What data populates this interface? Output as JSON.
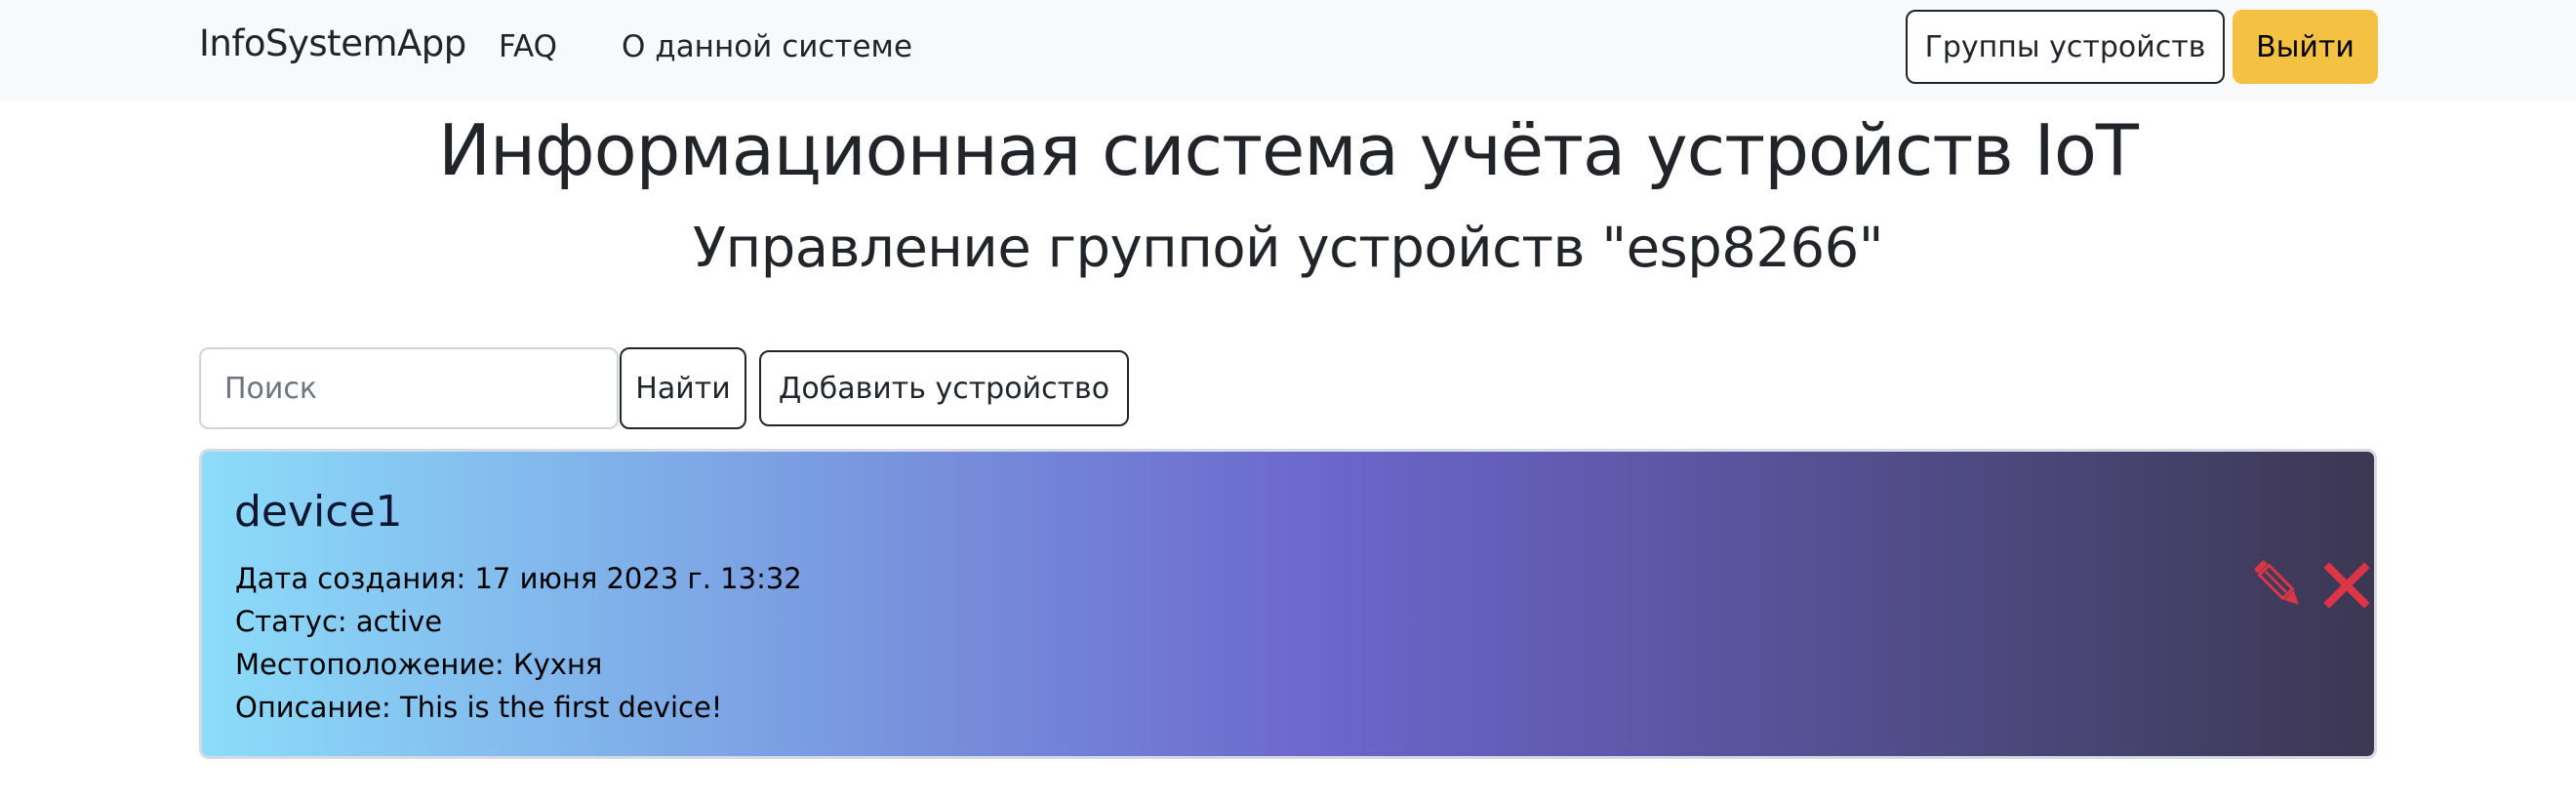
{
  "navbar": {
    "brand": "InfoSystemApp",
    "links": [
      {
        "label": "FAQ"
      },
      {
        "label": "О данной системе"
      }
    ],
    "groups_button": "Группы устройств",
    "logout_button": "Выйти"
  },
  "header": {
    "title": "Информационная система учёта устройств IoT",
    "subtitle": "Управление группой устройств \"esp8266\""
  },
  "toolbar": {
    "search_placeholder": "Поиск",
    "search_value": "",
    "find_button": "Найти",
    "add_button": "Добавить устройство"
  },
  "devices": [
    {
      "name": "device1",
      "created": "Дата создания: 17 июня 2023 г. 13:32",
      "status": "Статус: active",
      "location": "Местоположение: Кухня",
      "description": "Описание: This is the first device!"
    }
  ],
  "icons": {
    "edit": "pencil-icon",
    "delete": "close-icon"
  },
  "colors": {
    "navbar_bg": "#f8f9fa",
    "warning": "#f5c143",
    "danger": "#dc3545",
    "card_gradient_start": "#8cdcfa",
    "card_gradient_mid": "#6b66cc",
    "card_gradient_end": "#3c3752"
  }
}
